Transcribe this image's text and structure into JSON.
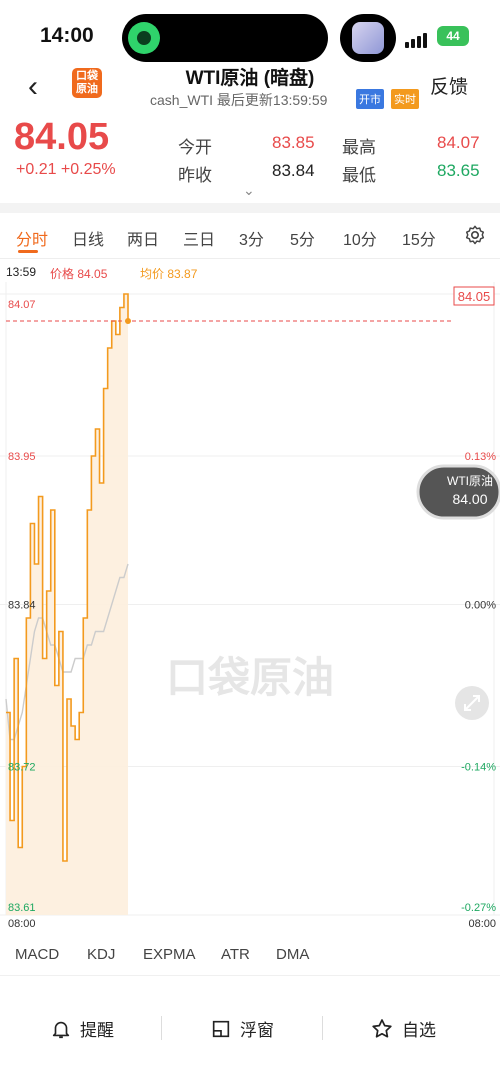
{
  "status_bar": {
    "time": "14:00",
    "battery": "44"
  },
  "header": {
    "logo_line1": "口袋",
    "logo_line2": "原油",
    "title": "WTI原油 (暗盘)",
    "subtitle": "cash_WTI 最后更新13:59:59",
    "tag_open": "开市",
    "tag_live": "实时",
    "feedback": "反馈"
  },
  "quote": {
    "price": "84.05",
    "change": "+0.21 +0.25%",
    "open_label": "今开",
    "open_value": "83.85",
    "high_label": "最高",
    "high_value": "84.07",
    "prev_close_label": "昨收",
    "prev_close_value": "83.84",
    "low_label": "最低",
    "low_value": "83.65"
  },
  "tabs": [
    "分时",
    "日线",
    "两日",
    "三日",
    "3分",
    "5分",
    "10分",
    "15分"
  ],
  "info": {
    "time": "13:59",
    "price": "价格 84.05",
    "avg": "均价 83.87"
  },
  "chart": {
    "left_ticks": [
      "84.07",
      "83.95",
      "83.84",
      "83.72",
      "83.61"
    ],
    "right_ticks": [
      "",
      "0.13%",
      "0.00%",
      "-0.14%",
      "-0.27%"
    ],
    "x_start": "08:00",
    "x_end": "08:00",
    "price_tag": "84.05",
    "float_name": "WTI原油",
    "float_value": "84.00",
    "watermark": "口袋原油",
    "colors": {
      "up": "#e84a4a",
      "down": "#1ea861",
      "price_line": "#f39a1e",
      "avg_line": "#cccccc"
    }
  },
  "indicators": [
    "MACD",
    "KDJ",
    "EXPMA",
    "ATR",
    "DMA"
  ],
  "bottom_bar": {
    "alert": "提醒",
    "float_window": "浮窗",
    "watchlist": "自选"
  },
  "chart_data": {
    "type": "line",
    "ylim": [
      83.61,
      84.07
    ],
    "series": [
      {
        "values": [
          83.76,
          83.68,
          83.8,
          83.66,
          83.72,
          83.83,
          83.9,
          83.87,
          83.92,
          83.8,
          83.85,
          83.91,
          83.78,
          83.82,
          83.65,
          83.77,
          83.75,
          83.74,
          83.76,
          83.83,
          83.91,
          83.95,
          83.97,
          83.93,
          84.0,
          84.03,
          84.05,
          84.04,
          84.06,
          84.07,
          84.05
        ]
      },
      {
        "values": [
          83.77,
          83.74,
          83.74,
          83.75,
          83.76,
          83.78,
          83.8,
          83.82,
          83.83,
          83.83,
          83.82,
          83.81,
          83.81,
          83.8,
          83.79,
          83.79,
          83.79,
          83.8,
          83.8,
          83.8,
          83.81,
          83.81,
          83.82,
          83.82,
          83.82,
          83.83,
          83.84,
          83.85,
          83.86,
          83.86,
          83.87
        ]
      }
    ]
  }
}
